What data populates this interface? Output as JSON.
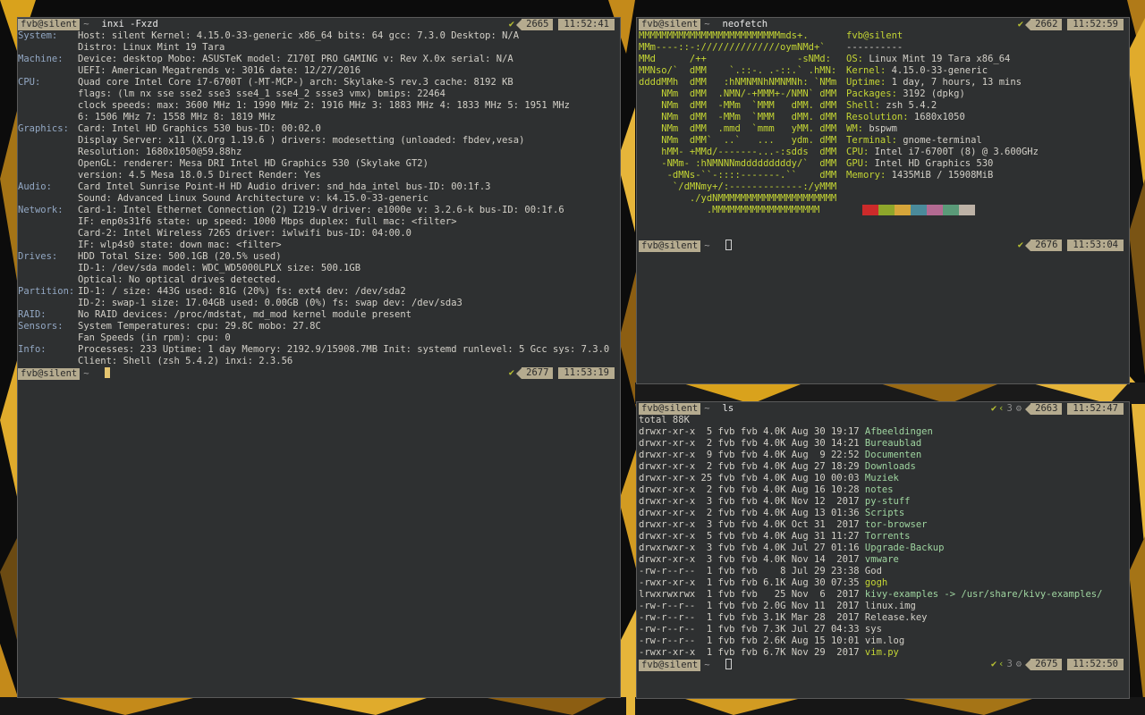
{
  "colors": {
    "prompt_tag": "#b5ab8f",
    "accent_green": "#c4d534",
    "terminal_bg": "#2e3031",
    "label_blue": "#93a8c4",
    "dir_green": "#9fd5a0"
  },
  "left_terminal": {
    "prompt_top": {
      "user": "fvb@silent",
      "dir": "~",
      "command": "inxi -Fxzd",
      "job": "2665",
      "time": "11:52:41"
    },
    "rows": [
      {
        "label": "System:",
        "text": "Host: silent Kernel: 4.15.0-33-generic x86_64 bits: 64 gcc: 7.3.0 Desktop: N/A"
      },
      {
        "label": "",
        "text": "Distro: Linux Mint 19 Tara"
      },
      {
        "label": "Machine:",
        "text": "Device: desktop Mobo: ASUSTeK model: Z170I PRO GAMING v: Rev X.0x serial: N/A"
      },
      {
        "label": "",
        "text": "UEFI: American Megatrends v: 3016 date: 12/27/2016"
      },
      {
        "label": "CPU:",
        "text": "Quad core Intel Core i7-6700T (-MT-MCP-) arch: Skylake-S rev.3 cache: 8192 KB"
      },
      {
        "label": "",
        "text": "flags: (lm nx sse sse2 sse3 sse4_1 sse4_2 ssse3 vmx) bmips: 22464"
      },
      {
        "label": "",
        "text": "clock speeds: max: 3600 MHz 1: 1990 MHz 2: 1916 MHz 3: 1883 MHz 4: 1833 MHz 5: 1951 MHz"
      },
      {
        "label": "",
        "text": "6: 1506 MHz 7: 1558 MHz 8: 1819 MHz"
      },
      {
        "label": "Graphics:",
        "text": "Card: Intel HD Graphics 530 bus-ID: 00:02.0"
      },
      {
        "label": "",
        "text": "Display Server: x11 (X.Org 1.19.6 ) drivers: modesetting (unloaded: fbdev,vesa)"
      },
      {
        "label": "",
        "text": "Resolution: 1680x1050@59.88hz"
      },
      {
        "label": "",
        "text": "OpenGL: renderer: Mesa DRI Intel HD Graphics 530 (Skylake GT2)"
      },
      {
        "label": "",
        "text": "version: 4.5 Mesa 18.0.5 Direct Render: Yes"
      },
      {
        "label": "Audio:",
        "text": "Card Intel Sunrise Point-H HD Audio driver: snd_hda_intel bus-ID: 00:1f.3"
      },
      {
        "label": "",
        "text": "Sound: Advanced Linux Sound Architecture v: k4.15.0-33-generic"
      },
      {
        "label": "Network:",
        "text": "Card-1: Intel Ethernet Connection (2) I219-V driver: e1000e v: 3.2.6-k bus-ID: 00:1f.6"
      },
      {
        "label": "",
        "text": "IF: enp0s31f6 state: up speed: 1000 Mbps duplex: full mac: <filter>"
      },
      {
        "label": "",
        "text": "Card-2: Intel Wireless 7265 driver: iwlwifi bus-ID: 04:00.0"
      },
      {
        "label": "",
        "text": "IF: wlp4s0 state: down mac: <filter>"
      },
      {
        "label": "Drives:",
        "text": "HDD Total Size: 500.1GB (20.5% used)"
      },
      {
        "label": "",
        "text": "ID-1: /dev/sda model: WDC_WD5000LPLX size: 500.1GB"
      },
      {
        "label": "",
        "text": "Optical: No optical drives detected."
      },
      {
        "label": "Partition:",
        "text": "ID-1: / size: 443G used: 81G (20%) fs: ext4 dev: /dev/sda2"
      },
      {
        "label": "",
        "text": "ID-2: swap-1 size: 17.04GB used: 0.00GB (0%) fs: swap dev: /dev/sda3"
      },
      {
        "label": "RAID:",
        "text": "No RAID devices: /proc/mdstat, md_mod kernel module present"
      },
      {
        "label": "Sensors:",
        "text": "System Temperatures: cpu: 29.8C mobo: 27.8C"
      },
      {
        "label": "",
        "text": "Fan Speeds (in rpm): cpu: 0"
      },
      {
        "label": "Info:",
        "text": "Processes: 233 Uptime: 1 day Memory: 2192.9/15908.7MB Init: systemd runlevel: 5 Gcc sys: 7.3.0"
      },
      {
        "label": "",
        "text": "Client: Shell (zsh 5.4.2) inxi: 2.3.56"
      }
    ],
    "prompt_bottom": {
      "user": "fvb@silent",
      "dir": "~",
      "job": "2677",
      "time": "11:53:19"
    }
  },
  "neofetch_terminal": {
    "prompt_top": {
      "user": "fvb@silent",
      "dir": "~",
      "command": "neofetch",
      "job": "2662",
      "time": "11:52:59"
    },
    "logo": [
      "MMMMMMMMMMMMMMMMMMMMMMMMMmds+.",
      "MMm----::-://////////////oymNMd+`",
      "MMd      /++                -sNMd:",
      "MMNso/`  dMM    `.::-. .-::.` .hMN:",
      "ddddMMh  dMM   :hNMNMNhNMNMNh: `NMm",
      "    NMm  dMM  .NMN/-+MMM+-/NMN` dMM",
      "    NMm  dMM  -MMm  `MMM   dMM. dMM",
      "    NMm  dMM  -MMm  `MMM   dMM. dMM",
      "    NMm  dMM  .mmd  `mmm   yMM. dMM",
      "    NMm  dMM`  ..`   ...   ydm. dMM",
      "    hMM- +MMd/-------...-:sdds  dMM",
      "    -NMm- :hNMNNNmdddddddddy/`  dMM",
      "     -dMNs-``-::::-------.``    dMM",
      "      `/dMNmy+/:-------------:/yMMM",
      "         ./ydNMMMMMMMMMMMMMMMMMMMMM",
      "            .MMMMMMMMMMMMMMMMMMM"
    ],
    "user_host": "fvb@silent",
    "underline": "----------",
    "info": [
      {
        "key": "OS",
        "value": "Linux Mint 19 Tara x86_64"
      },
      {
        "key": "Kernel",
        "value": "4.15.0-33-generic"
      },
      {
        "key": "Uptime",
        "value": "1 day, 7 hours, 13 mins"
      },
      {
        "key": "Packages",
        "value": "3192 (dpkg)"
      },
      {
        "key": "Shell",
        "value": "zsh 5.4.2"
      },
      {
        "key": "Resolution",
        "value": "1680x1050"
      },
      {
        "key": "WM",
        "value": "bspwm"
      },
      {
        "key": "Terminal",
        "value": "gnome-terminal"
      },
      {
        "key": "CPU",
        "value": "Intel i7-6700T (8) @ 3.600GHz"
      },
      {
        "key": "GPU",
        "value": "Intel HD Graphics 530"
      },
      {
        "key": "Memory",
        "value": "1435MiB / 15908MiB"
      }
    ],
    "swatches": [
      "#cc2a2a",
      "#8ea62b",
      "#d6a53a",
      "#4a8a9a",
      "#b36a92",
      "#5a9a78",
      "#bdb2a6"
    ],
    "prompt_bottom": {
      "user": "fvb@silent",
      "dir": "~",
      "job": "2676",
      "time": "11:53:04"
    }
  },
  "ls_terminal": {
    "prompt_top": {
      "user": "fvb@silent",
      "dir": "~",
      "command": "ls",
      "jobs": "3",
      "job": "2663",
      "time": "11:52:47"
    },
    "total": "total 88K",
    "entries": [
      {
        "perm": "drwxr-xr-x",
        "links": "5",
        "owner": "fvb",
        "group": "fvb",
        "size": "4.0K",
        "month": "Aug",
        "day": "30",
        "time": "19:17",
        "name": "Afbeeldingen",
        "kind": "dir"
      },
      {
        "perm": "drwxr-xr-x",
        "links": "2",
        "owner": "fvb",
        "group": "fvb",
        "size": "4.0K",
        "month": "Aug",
        "day": "30",
        "time": "14:21",
        "name": "Bureaublad",
        "kind": "dir"
      },
      {
        "perm": "drwxr-xr-x",
        "links": "9",
        "owner": "fvb",
        "group": "fvb",
        "size": "4.0K",
        "month": "Aug",
        "day": "9",
        "time": "22:52",
        "name": "Documenten",
        "kind": "dir"
      },
      {
        "perm": "drwxr-xr-x",
        "links": "2",
        "owner": "fvb",
        "group": "fvb",
        "size": "4.0K",
        "month": "Aug",
        "day": "27",
        "time": "18:29",
        "name": "Downloads",
        "kind": "dir"
      },
      {
        "perm": "drwxr-xr-x",
        "links": "25",
        "owner": "fvb",
        "group": "fvb",
        "size": "4.0K",
        "month": "Aug",
        "day": "10",
        "time": "00:03",
        "name": "Muziek",
        "kind": "dir"
      },
      {
        "perm": "drwxr-xr-x",
        "links": "2",
        "owner": "fvb",
        "group": "fvb",
        "size": "4.0K",
        "month": "Aug",
        "day": "16",
        "time": "10:28",
        "name": "notes",
        "kind": "dir"
      },
      {
        "perm": "drwxr-xr-x",
        "links": "3",
        "owner": "fvb",
        "group": "fvb",
        "size": "4.0K",
        "month": "Nov",
        "day": "12",
        "time": "2017",
        "name": "py-stuff",
        "kind": "dir"
      },
      {
        "perm": "drwxr-xr-x",
        "links": "2",
        "owner": "fvb",
        "group": "fvb",
        "size": "4.0K",
        "month": "Aug",
        "day": "13",
        "time": "01:36",
        "name": "Scripts",
        "kind": "dir"
      },
      {
        "perm": "drwxr-xr-x",
        "links": "3",
        "owner": "fvb",
        "group": "fvb",
        "size": "4.0K",
        "month": "Oct",
        "day": "31",
        "time": "2017",
        "name": "tor-browser",
        "kind": "dir"
      },
      {
        "perm": "drwxr-xr-x",
        "links": "5",
        "owner": "fvb",
        "group": "fvb",
        "size": "4.0K",
        "month": "Aug",
        "day": "31",
        "time": "11:27",
        "name": "Torrents",
        "kind": "dir"
      },
      {
        "perm": "drwxrwxr-x",
        "links": "3",
        "owner": "fvb",
        "group": "fvb",
        "size": "4.0K",
        "month": "Jul",
        "day": "27",
        "time": "01:16",
        "name": "Upgrade-Backup",
        "kind": "dir"
      },
      {
        "perm": "drwxr-xr-x",
        "links": "3",
        "owner": "fvb",
        "group": "fvb",
        "size": "4.0K",
        "month": "Nov",
        "day": "14",
        "time": "2017",
        "name": "vmware",
        "kind": "dir"
      },
      {
        "perm": "-rw-r--r--",
        "links": "1",
        "owner": "fvb",
        "group": "fvb",
        "size": "8",
        "month": "Jul",
        "day": "29",
        "time": "23:38",
        "name": "God",
        "kind": "file"
      },
      {
        "perm": "-rwxr-xr-x",
        "links": "1",
        "owner": "fvb",
        "group": "fvb",
        "size": "6.1K",
        "month": "Aug",
        "day": "30",
        "time": "07:35",
        "name": "gogh",
        "kind": "exe"
      },
      {
        "perm": "lrwxrwxrwx",
        "links": "1",
        "owner": "fvb",
        "group": "fvb",
        "size": "25",
        "month": "Nov",
        "day": "6",
        "time": "2017",
        "name": "kivy-examples -> /usr/share/kivy-examples/",
        "kind": "link"
      },
      {
        "perm": "-rw-r--r--",
        "links": "1",
        "owner": "fvb",
        "group": "fvb",
        "size": "2.0G",
        "month": "Nov",
        "day": "11",
        "time": "2017",
        "name": "linux.img",
        "kind": "file"
      },
      {
        "perm": "-rw-r--r--",
        "links": "1",
        "owner": "fvb",
        "group": "fvb",
        "size": "3.1K",
        "month": "Mar",
        "day": "28",
        "time": "2017",
        "name": "Release.key",
        "kind": "file"
      },
      {
        "perm": "-rw-r--r--",
        "links": "1",
        "owner": "fvb",
        "group": "fvb",
        "size": "7.3K",
        "month": "Jul",
        "day": "27",
        "time": "04:33",
        "name": "sys",
        "kind": "file"
      },
      {
        "perm": "-rw-r--r--",
        "links": "1",
        "owner": "fvb",
        "group": "fvb",
        "size": "2.6K",
        "month": "Aug",
        "day": "15",
        "time": "10:01",
        "name": "vim.log",
        "kind": "file"
      },
      {
        "perm": "-rwxr-xr-x",
        "links": "1",
        "owner": "fvb",
        "group": "fvb",
        "size": "6.7K",
        "month": "Nov",
        "day": "29",
        "time": "2017",
        "name": "vim.py",
        "kind": "exe"
      }
    ],
    "prompt_bottom": {
      "user": "fvb@silent",
      "dir": "~",
      "jobs": "3",
      "job": "2675",
      "time": "11:52:50"
    }
  }
}
